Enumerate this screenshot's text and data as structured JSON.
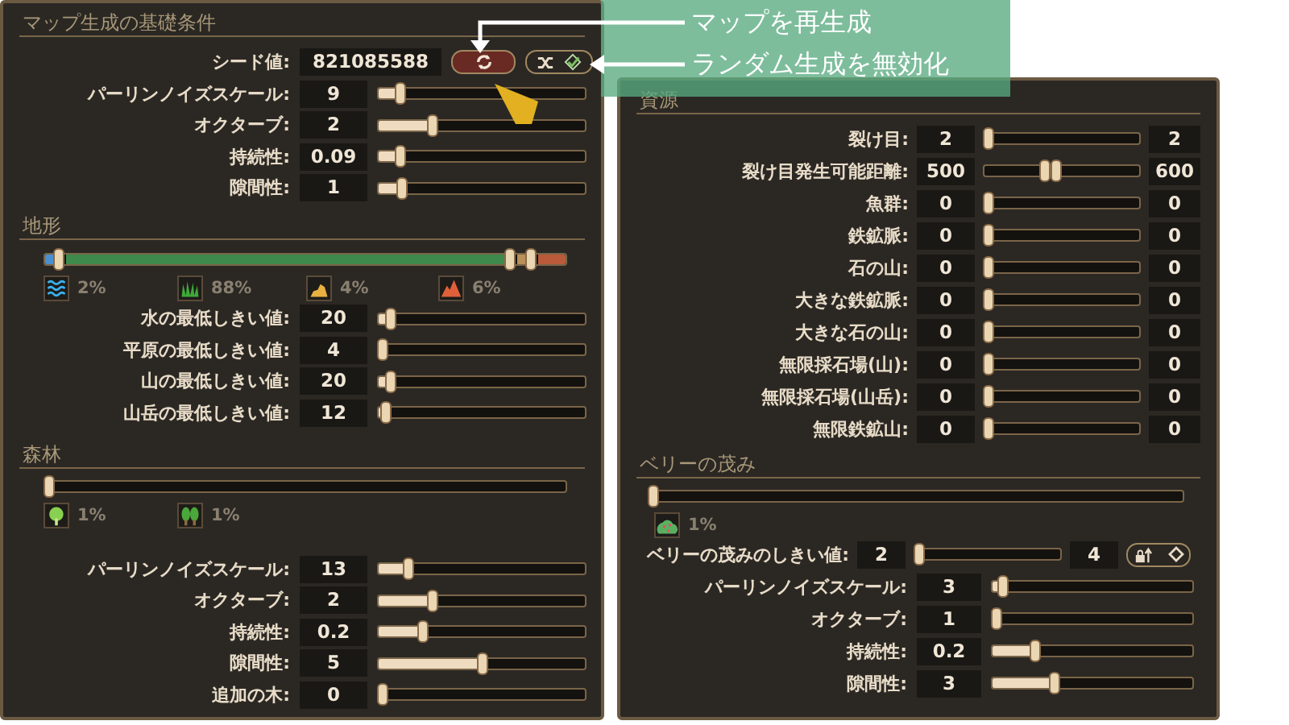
{
  "basic": {
    "title": "マップ生成の基礎条件",
    "seed": {
      "label": "シード値:",
      "value": "821085588"
    },
    "buttons": [
      {
        "kind": "regenerate"
      },
      {
        "kind": "randomize"
      }
    ],
    "rows": [
      {
        "label": "パーリンノイズスケール:",
        "value": "9",
        "level": 0.09
      },
      {
        "label": "オクターブ:",
        "value": "2",
        "level": 0.25
      },
      {
        "label": "持続性:",
        "value": "0.09",
        "level": 0.09
      },
      {
        "label": "隙間性:",
        "value": "1",
        "level": 0.1
      }
    ]
  },
  "terrain": {
    "title": "地形",
    "thumbs": [
      {
        "level": 0.02
      },
      {
        "level": 0.9
      },
      {
        "level": 0.94
      }
    ],
    "shares": [
      {
        "kind": "water",
        "text": "2%"
      },
      {
        "kind": "grass",
        "text": "88%"
      },
      {
        "kind": "hill",
        "text": "4%"
      },
      {
        "kind": "mountain",
        "text": "6%"
      }
    ],
    "rows": [
      {
        "label": "水の最低しきい値:",
        "value": "20",
        "level": 0.04
      },
      {
        "label": "平原の最低しきい値:",
        "value": "4",
        "level": 0.0
      },
      {
        "label": "山の最低しきい値:",
        "value": "20",
        "level": 0.04
      },
      {
        "label": "山岳の最低しきい値:",
        "value": "12",
        "level": 0.02
      }
    ]
  },
  "forest": {
    "title": "森林",
    "thumbs": [
      {
        "level": 0
      }
    ],
    "shares": [
      {
        "kind": "tree",
        "text": "1%"
      },
      {
        "kind": "trees",
        "text": "1%"
      }
    ],
    "rows": [
      {
        "label": "パーリンノイズスケール:",
        "value": "13",
        "level": 0.13
      },
      {
        "label": "オクターブ:",
        "value": "2",
        "level": 0.25
      },
      {
        "label": "持続性:",
        "value": "0.2",
        "level": 0.2
      },
      {
        "label": "隙間性:",
        "value": "5",
        "level": 0.5
      },
      {
        "label": "追加の木:",
        "value": "0",
        "level": 0
      }
    ]
  },
  "resources": {
    "title": "資源",
    "rows": [
      {
        "label": "裂け目:",
        "min": "2",
        "max": "2",
        "thumbs": [
          {
            "level": 0
          },
          {
            "level": 0
          }
        ]
      },
      {
        "label": "裂け目発生可能距離:",
        "min": "500",
        "max": "600",
        "thumbs": [
          {
            "level": 0.38
          },
          {
            "level": 0.46
          }
        ]
      },
      {
        "label": "魚群:",
        "min": "0",
        "max": "0",
        "thumbs": [
          {
            "level": 0
          },
          {
            "level": 0
          }
        ]
      },
      {
        "label": "鉄鉱脈:",
        "min": "0",
        "max": "0",
        "thumbs": [
          {
            "level": 0
          },
          {
            "level": 0
          }
        ]
      },
      {
        "label": "石の山:",
        "min": "0",
        "max": "0",
        "thumbs": [
          {
            "level": 0
          },
          {
            "level": 0
          }
        ]
      },
      {
        "label": "大きな鉄鉱脈:",
        "min": "0",
        "max": "0",
        "thumbs": [
          {
            "level": 0
          },
          {
            "level": 0
          }
        ]
      },
      {
        "label": "大きな石の山:",
        "min": "0",
        "max": "0",
        "thumbs": [
          {
            "level": 0
          },
          {
            "level": 0
          }
        ]
      },
      {
        "label": "無限採石場(山):",
        "min": "0",
        "max": "0",
        "thumbs": [
          {
            "level": 0
          },
          {
            "level": 0
          }
        ]
      },
      {
        "label": "無限採石場(山岳):",
        "min": "0",
        "max": "0",
        "thumbs": [
          {
            "level": 0
          },
          {
            "level": 0
          }
        ]
      },
      {
        "label": "無限鉄鉱山:",
        "min": "0",
        "max": "0",
        "thumbs": [
          {
            "level": 0
          },
          {
            "level": 0
          }
        ]
      }
    ]
  },
  "berry": {
    "title": "ベリーの茂み",
    "thumbs": [
      {
        "level": 0
      }
    ],
    "shares": [
      {
        "kind": "bush",
        "text": "1%"
      }
    ],
    "threshold": {
      "label": "ベリーの茂みのしきい値:",
      "min": "2",
      "max": "4",
      "thumbs": [
        {
          "level": 0
        },
        {
          "level": 0
        }
      ],
      "button": {
        "kind": "lock"
      }
    },
    "rows": [
      {
        "label": "パーリンノイズスケール:",
        "value": "3",
        "level": 0.03
      },
      {
        "label": "オクターブ:",
        "value": "1",
        "level": 0
      },
      {
        "label": "持続性:",
        "value": "0.2",
        "level": 0.2
      },
      {
        "label": "隙間性:",
        "value": "3",
        "level": 0.3
      }
    ]
  },
  "callout": {
    "items": [
      {
        "text": "マップを再生成"
      },
      {
        "text": "ランダム生成を無効化"
      }
    ]
  }
}
